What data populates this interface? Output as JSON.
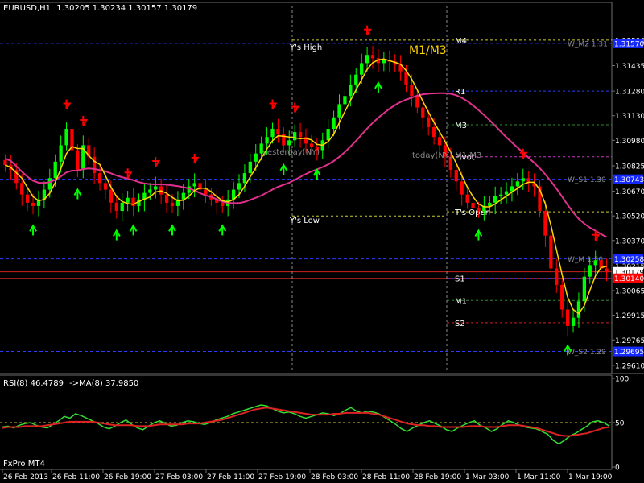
{
  "header": {
    "symbol": "EURUSD,H1",
    "ohlc": "1.30205 1.30234 1.30157 1.30179"
  },
  "colors": {
    "bull": "#00ff00",
    "bear": "#ff0000",
    "ma_fast": "#ffd700",
    "ma_slow": "#e0318c",
    "grid_blue": "#2a3cff",
    "grid_green": "#2e8b2e",
    "grid_red": "#cc2222",
    "grid_yellow": "#cccc33",
    "rsi": "#33dd33",
    "rsi_ma": "#dd2222",
    "label_box": "#1428ff"
  },
  "watermark": "FxPro MT4",
  "chart_data": [
    {
      "type": "candlestick",
      "title": "EURUSD,H1",
      "ylim": [
        1.2958,
        1.318
      ],
      "y_ticks": [
        "1.31590",
        "1.31435",
        "1.31280",
        "1.31130",
        "1.30980",
        "1.30825",
        "1.30670",
        "1.30520",
        "1.30370",
        "1.30215",
        "1.30065",
        "1.29915",
        "1.29765",
        "1.29610"
      ],
      "x_ticks": [
        "26 Feb 2013",
        "26 Feb 11:00",
        "26 Feb 19:00",
        "27 Feb 03:00",
        "27 Feb 11:00",
        "27 Feb 19:00",
        "28 Feb 03:00",
        "28 Feb 11:00",
        "28 Feb 19:00",
        "1 Mar 03:00",
        "1 Mar 11:00",
        "1 Mar 19:00"
      ],
      "price_tags": [
        {
          "text": "1.31570",
          "value": 1.3157,
          "color": "#1428ff"
        },
        {
          "text": "1.30743",
          "value": 1.30743,
          "color": "#1428ff"
        },
        {
          "text": "1.30258",
          "value": 1.30258,
          "color": "#1428ff"
        },
        {
          "text": "1.30179",
          "value": 1.30179,
          "color": "#ffffff"
        },
        {
          "text": "1.30140",
          "value": 1.3014,
          "color": "#ff0000"
        },
        {
          "text": "1.29695",
          "value": 1.29695,
          "color": "#1428ff"
        }
      ],
      "levels_full": [
        {
          "label": "W_M2 1.31",
          "value": 1.3157,
          "color": "#2a3cff"
        },
        {
          "label": "W_S1 1.30",
          "value": 1.30743,
          "color": "#2a3cff"
        },
        {
          "label": "W_M 1.30",
          "value": 1.30258,
          "color": "#2a3cff"
        },
        {
          "label": "W_S2 1.29",
          "value": 1.29695,
          "color": "#2a3cff"
        },
        {
          "label": "",
          "value": 1.3018,
          "color": "#cc2222"
        },
        {
          "label": "",
          "value": 1.3014,
          "color": "#cc2222"
        }
      ],
      "levels_daily": [
        {
          "label": "M4",
          "value": 1.3159,
          "color": "#cccc33"
        },
        {
          "label": "R1",
          "value": 1.3128,
          "color": "#2a3cff"
        },
        {
          "label": "M3",
          "value": 1.31075,
          "color": "#2e8b2e"
        },
        {
          "label": "Pivot",
          "value": 1.3088,
          "color": "#cc33cc"
        },
        {
          "label": "T's Open",
          "value": 1.30545,
          "color": "#cccc33"
        },
        {
          "label": "S1",
          "value": 1.3014,
          "color": "#2a3cff"
        },
        {
          "label": "M1",
          "value": 1.30005,
          "color": "#2e8b2e"
        },
        {
          "label": "S2",
          "value": 1.2987,
          "color": "#cc2222"
        }
      ],
      "yday_levels": [
        {
          "label": "Y's High",
          "value": 1.3159
        },
        {
          "label": "Y's Low",
          "value": 1.3052
        }
      ],
      "annotations": [
        {
          "text": "M1/M3",
          "color": "#ffd700"
        },
        {
          "text": "yesterday(NY)",
          "color": "#888888"
        },
        {
          "text": "today(NY) M1/M3",
          "color": "#888888"
        }
      ],
      "close": [
        1.3083,
        1.308,
        1.3072,
        1.3065,
        1.306,
        1.3058,
        1.3062,
        1.3068,
        1.3075,
        1.3085,
        1.3095,
        1.3105,
        1.3092,
        1.308,
        1.3095,
        1.3088,
        1.3078,
        1.3072,
        1.3068,
        1.306,
        1.3055,
        1.306,
        1.3063,
        1.3058,
        1.3062,
        1.3066,
        1.3068,
        1.307,
        1.3065,
        1.306,
        1.3058,
        1.3062,
        1.3066,
        1.307,
        1.3072,
        1.3068,
        1.3065,
        1.3062,
        1.306,
        1.3058,
        1.3062,
        1.3068,
        1.3072,
        1.3078,
        1.3085,
        1.309,
        1.3096,
        1.31,
        1.3105,
        1.3102,
        1.3095,
        1.3098,
        1.3103,
        1.31,
        1.3096,
        1.3094,
        1.3092,
        1.3098,
        1.3105,
        1.3112,
        1.312,
        1.3125,
        1.3132,
        1.3138,
        1.3145,
        1.315,
        1.3148,
        1.3145,
        1.3147,
        1.3146,
        1.3144,
        1.314,
        1.3132,
        1.3125,
        1.3118,
        1.3112,
        1.3106,
        1.31,
        1.3095,
        1.3088,
        1.308,
        1.3073,
        1.3065,
        1.306,
        1.3057,
        1.3055,
        1.3058,
        1.306,
        1.3064,
        1.3065,
        1.3067,
        1.307,
        1.3073,
        1.3075,
        1.3072,
        1.307,
        1.3055,
        1.304,
        1.302,
        1.301,
        1.2995,
        1.2985,
        1.299,
        1.3,
        1.3015,
        1.3022,
        1.3025,
        1.302,
        1.3018
      ],
      "series": [
        {
          "name": "",
          "style": "fast MA"
        },
        {
          "name": "",
          "style": "slow MA"
        }
      ]
    },
    {
      "type": "line",
      "title": "RSI(8) 46.4789 ->MA(8) 37.9850",
      "label_rsi": "RSI(8) 46.4789",
      "label_ma": "->MA(8) 37.9850",
      "ylim": [
        0,
        100
      ],
      "y_ticks": [
        "100",
        "50",
        "0"
      ],
      "tick_values": [
        100,
        50,
        0
      ],
      "level": 50,
      "series": [
        {
          "name": "RSI(8)",
          "values": [
            45,
            46,
            44,
            47,
            49,
            50,
            47,
            45,
            44,
            48,
            52,
            57,
            55,
            60,
            58,
            55,
            52,
            49,
            45,
            43,
            46,
            50,
            53,
            48,
            44,
            42,
            46,
            50,
            52,
            49,
            46,
            47,
            50,
            52,
            51,
            49,
            48,
            50,
            53,
            55,
            57,
            60,
            62,
            64,
            66,
            68,
            70,
            69,
            66,
            63,
            61,
            62,
            60,
            57,
            55,
            57,
            59,
            61,
            60,
            58,
            60,
            64,
            67,
            63,
            61,
            63,
            62,
            60,
            56,
            52,
            48,
            43,
            40,
            44,
            47,
            50,
            52,
            49,
            46,
            42,
            40,
            44,
            47,
            50,
            52,
            47,
            44,
            40,
            43,
            48,
            52,
            50,
            47,
            45,
            44,
            43,
            40,
            37,
            30,
            26,
            30,
            35,
            38,
            42,
            46,
            51,
            52,
            50,
            46
          ]
        },
        {
          "name": "MA(8)",
          "values": [
            44,
            45,
            45,
            45,
            46,
            46,
            46,
            46,
            47,
            48,
            49,
            50,
            51,
            51,
            51,
            51,
            51,
            50,
            49,
            48,
            47,
            47,
            47,
            47,
            46,
            46,
            46,
            47,
            48,
            48,
            48,
            48,
            48,
            49,
            49,
            49,
            50,
            51,
            52,
            53,
            55,
            57,
            59,
            61,
            63,
            65,
            66,
            67,
            66,
            65,
            64,
            63,
            62,
            61,
            60,
            59,
            59,
            59,
            59,
            60,
            60,
            61,
            61,
            61,
            61,
            61,
            60,
            59,
            57,
            55,
            53,
            51,
            49,
            48,
            47,
            47,
            46,
            46,
            45,
            45,
            45,
            45,
            45,
            46,
            46,
            46,
            45,
            45,
            45,
            46,
            47,
            47,
            47,
            46,
            45,
            44,
            42,
            40,
            38,
            36,
            35,
            35,
            36,
            37,
            38,
            40,
            42,
            44,
            45
          ]
        }
      ]
    }
  ]
}
